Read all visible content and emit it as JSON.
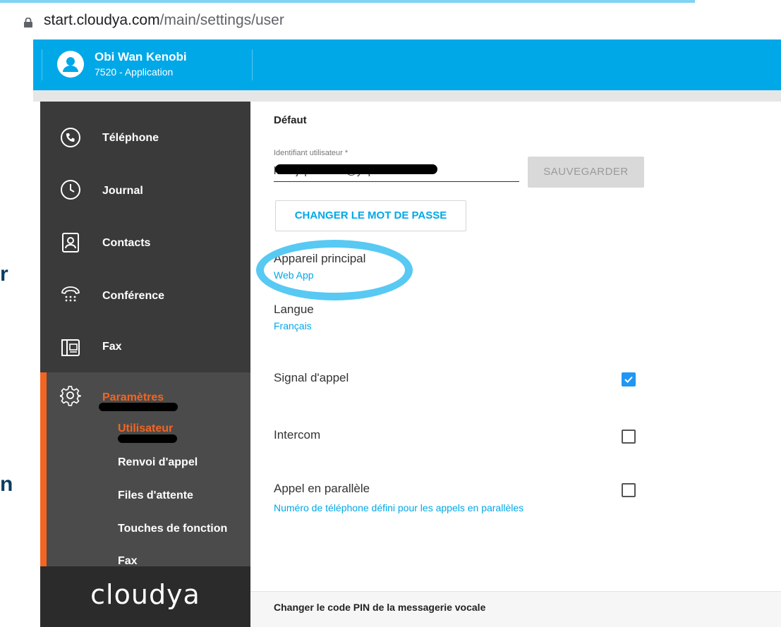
{
  "browser": {
    "url_host": "start.cloudya.com",
    "url_path": "/main/settings/user"
  },
  "header": {
    "user_name": "Obi Wan Kenobi",
    "user_sub": "7520 - Application",
    "bg_color": "#00a8e8"
  },
  "edge_letters": [
    "r",
    "n"
  ],
  "sidebar": {
    "items": [
      {
        "label": "Téléphone",
        "icon": "phone-icon"
      },
      {
        "label": "Journal",
        "icon": "clock-icon"
      },
      {
        "label": "Contacts",
        "icon": "contact-card-icon"
      },
      {
        "label": "Conférence",
        "icon": "conference-phone-icon"
      },
      {
        "label": "Fax",
        "icon": "fax-icon"
      }
    ],
    "settings": {
      "label": "Paramètres",
      "icon": "gear-icon",
      "sub_items": [
        {
          "label": "Utilisateur",
          "active": true
        },
        {
          "label": "Renvoi d'appel",
          "active": false
        },
        {
          "label": "Files d'attente",
          "active": false
        },
        {
          "label": "Touches de fonction",
          "active": false
        },
        {
          "label": "Fax",
          "active": false
        }
      ]
    },
    "brand": "cloudya",
    "accent_color": "#f26522"
  },
  "main": {
    "section_title": "Défaut",
    "user_id_label": "Identifiant utilisateur *",
    "user_id_value": "kovejepet-6243@yopmail.com",
    "save_button": "SAUVEGARDER",
    "change_password_button": "CHANGER LE MOT DE PASSE",
    "primary_device_label": "Appareil principal",
    "primary_device_value": "Web App",
    "language_label": "Langue",
    "language_value": "Français",
    "call_waiting_label": "Signal d'appel",
    "call_waiting_checked": true,
    "intercom_label": "Intercom",
    "intercom_checked": false,
    "parallel_call_label": "Appel en parallèle",
    "parallel_call_checked": false,
    "parallel_call_link": "Numéro de téléphone défini pour les appels en parallèles",
    "voicemail_pin": "Changer le code PIN de la messagerie vocale"
  }
}
